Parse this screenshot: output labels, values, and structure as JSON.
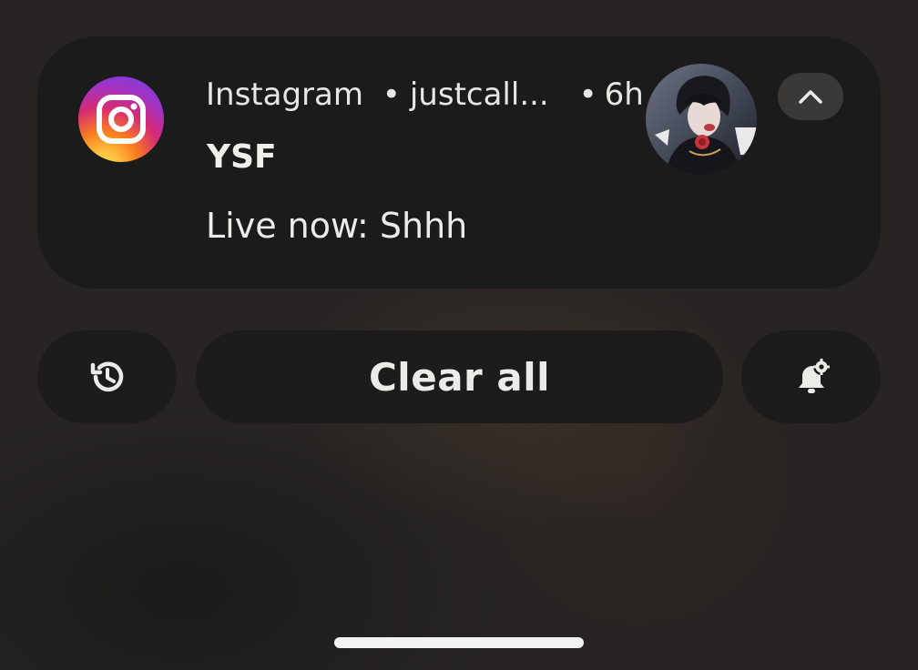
{
  "notification": {
    "app_name": "Instagram",
    "separator": "•",
    "account": "justcall...",
    "time": "6h",
    "title": "YSF",
    "body": "Live now: Shhh",
    "app_icon": "instagram-icon",
    "avatar_icon": "profile-avatar",
    "expand_icon": "chevron-up-icon"
  },
  "actions": {
    "history_icon": "history-icon",
    "clear_all_label": "Clear all",
    "settings_icon": "notification-settings-icon"
  },
  "colors": {
    "card_bg": "#1c1b1b",
    "pill_bg": "#1d1c1b",
    "text": "#ecebe8",
    "instagram_gradient": [
      "#fdd447",
      "#fa7e1e",
      "#d62976",
      "#6f3ee6"
    ]
  }
}
